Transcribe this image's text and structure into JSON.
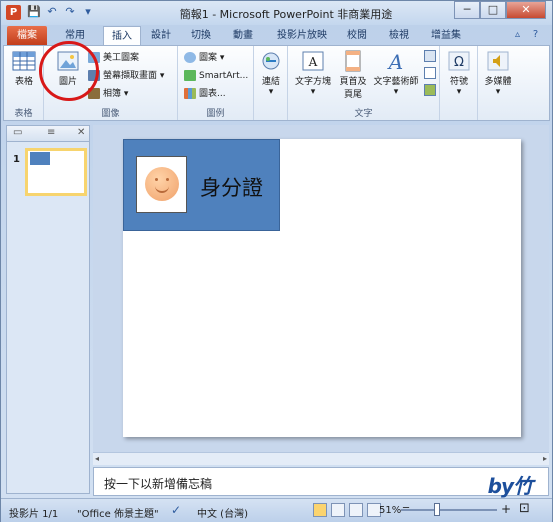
{
  "app": {
    "title": "簡報1 - Microsoft PowerPoint 非商業用途",
    "icon_letter": "P"
  },
  "qat": {
    "save_icon": "💾",
    "undo_icon": "↶",
    "redo_icon": "↷",
    "customize_icon": "▾"
  },
  "window_buttons": {
    "minimize": "─",
    "maximize": "□",
    "close": "✕"
  },
  "tabs": [
    {
      "label": "檔案"
    },
    {
      "label": "常用"
    },
    {
      "label": "插入"
    },
    {
      "label": "設計"
    },
    {
      "label": "切換"
    },
    {
      "label": "動畫"
    },
    {
      "label": "投影片放映"
    },
    {
      "label": "校閱"
    },
    {
      "label": "檢視"
    },
    {
      "label": "增益集"
    }
  ],
  "help": {
    "collapse_icon": "▵",
    "help_icon": "?"
  },
  "ribbon": {
    "groups": {
      "table": "表格",
      "images": "圖像",
      "illustrations": "圖例",
      "links": "",
      "text": "文字",
      "symbols": "",
      "media": ""
    },
    "buttons": {
      "table": "表格",
      "picture": "圖片",
      "clipart": "美工圖案",
      "screenshot": "螢幕擷取畫面",
      "album": "相簿",
      "shapes": "圖案",
      "smartart": "SmartArt...",
      "chart": "圖表...",
      "link": "連結",
      "textbox": "文字方塊",
      "header_footer_1": "頁首及",
      "header_footer_2": "頁尾",
      "wordart": "文字藝術師",
      "symbol": "符號",
      "media": "多媒體"
    }
  },
  "panel": {
    "slide_number": "1"
  },
  "slide": {
    "id_title": "身分證"
  },
  "notes": {
    "text": "按一下以新增備忘稿",
    "logo": "by竹"
  },
  "status": {
    "slide_info": "投影片 1/1",
    "theme": "\"Office 佈景主題\"",
    "language": "中文 (台灣)",
    "zoom": "51%",
    "zoom_minus": "─",
    "zoom_plus": "+"
  }
}
